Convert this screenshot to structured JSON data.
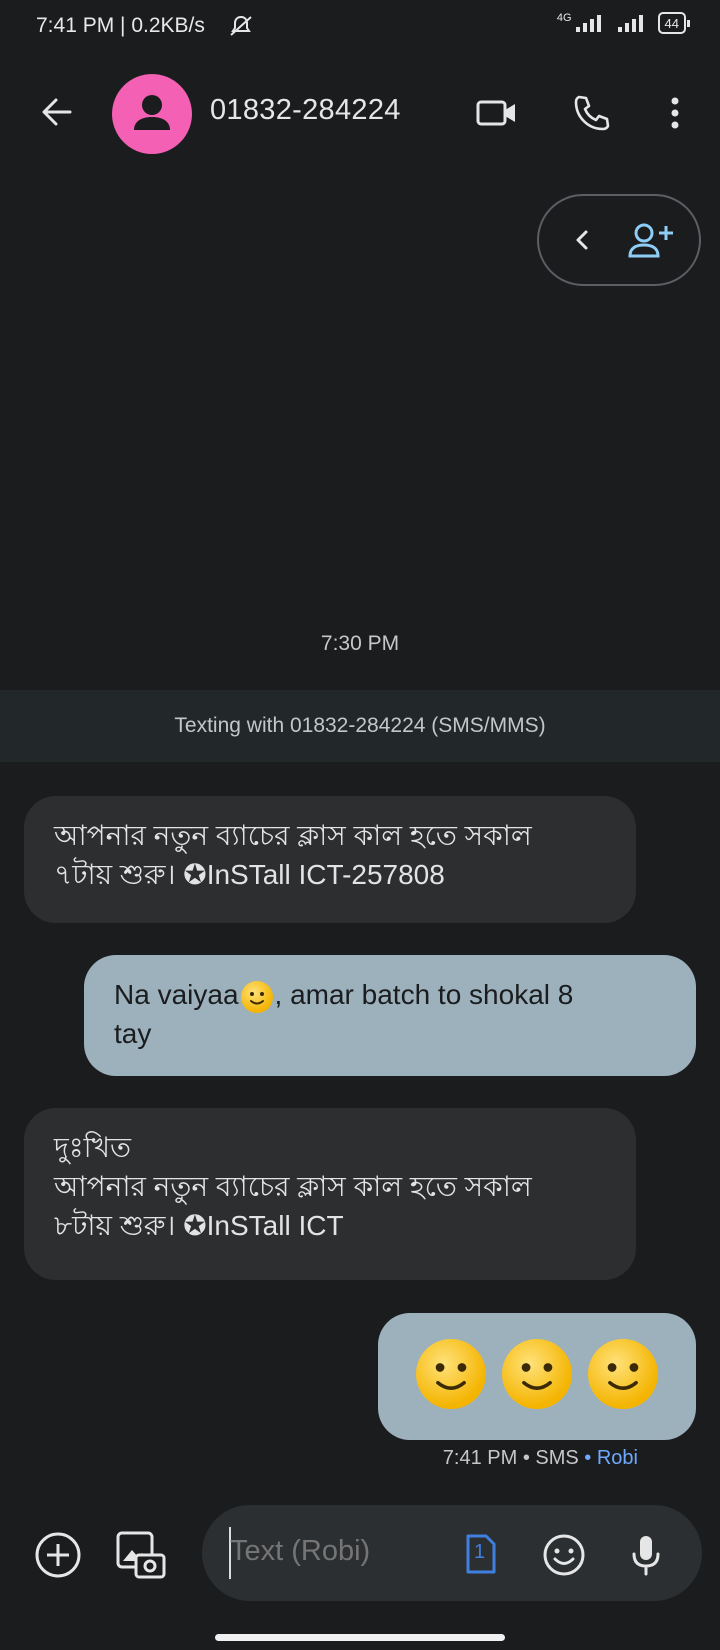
{
  "status": {
    "time_speed": "7:41 PM | 0.2KB/s",
    "network": "4G",
    "battery": "44"
  },
  "header": {
    "contact": "01832-284224"
  },
  "conversation": {
    "time_label": "7:30 PM",
    "banner": "Texting with 01832-284224 (SMS/MMS)",
    "messages": [
      {
        "dir": "in",
        "lines": [
          "আপনার নতুন ব্যাচের ক্লাস কাল হতে সকাল",
          "৭টায় শুরু। ✪InSTall ICT-257808"
        ]
      },
      {
        "dir": "out",
        "text_before_emoji": "Na vaiyaa",
        "text_after_emoji": ", amar batch to shokal 8",
        "line2": "tay"
      },
      {
        "dir": "in",
        "lines": [
          "দুঃখিত",
          "আপনার নতুন ব্যাচের ক্লাস কাল হতে সকাল",
          "৮টায় শুরু। ✪InSTall ICT"
        ]
      },
      {
        "dir": "out",
        "emoji_count": "3",
        "emoji_name": "slightly-smiling-face"
      }
    ],
    "meta": {
      "time": "7:41 PM",
      "sep": " • ",
      "type": "SMS",
      "carrier": "Robi"
    }
  },
  "composer": {
    "placeholder": "Text (Robi)",
    "sim_number": "1"
  },
  "colors": {
    "accent": "#6ea8ff",
    "avatar": "#f360b4",
    "outgoing": "#9db1bd",
    "incoming": "#2c2e30"
  }
}
